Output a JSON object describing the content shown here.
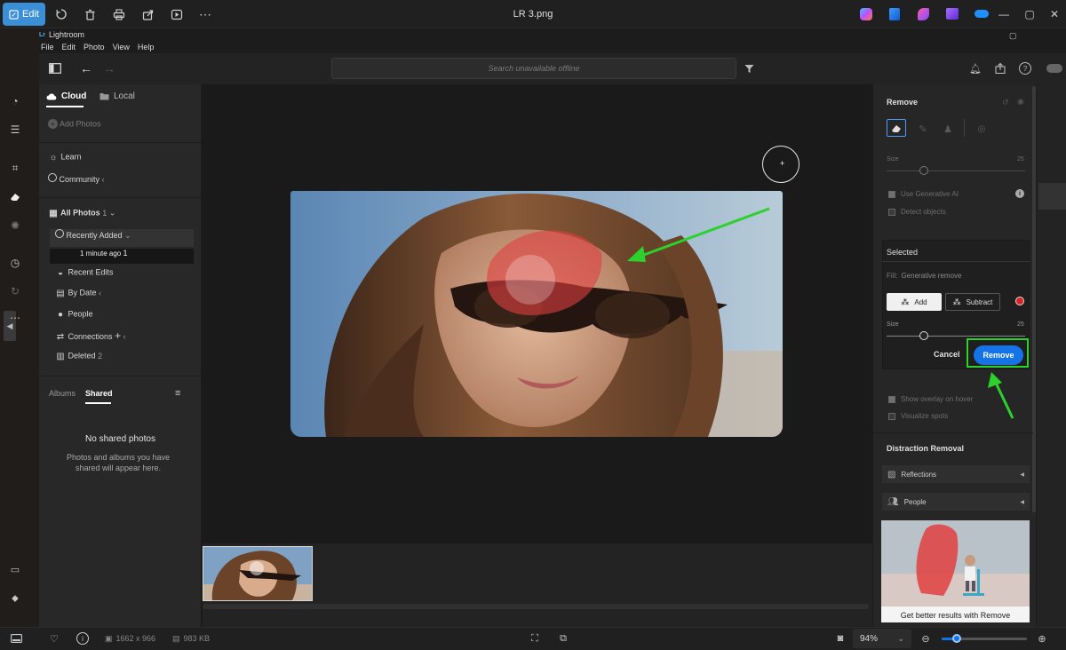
{
  "viewer": {
    "edit_label": "Edit",
    "file_name": "LR 3.png"
  },
  "lightroom": {
    "app_name": "Lightroom",
    "menu": [
      "File",
      "Edit",
      "Photo",
      "View",
      "Help"
    ],
    "search_placeholder": "Search unavailable offline"
  },
  "left_panel": {
    "tabs": {
      "cloud": "Cloud",
      "local": "Local"
    },
    "add_photos": "Add Photos",
    "learn": "Learn",
    "community": "Community",
    "all_photos": {
      "label": "All Photos",
      "count": "1"
    },
    "recently_added": "Recently Added",
    "one_minute_ago": {
      "label": "1 minute ago",
      "count": "1"
    },
    "recent_edits": "Recent Edits",
    "by_date": "By Date",
    "people": "People",
    "connections": "Connections",
    "deleted": {
      "label": "Deleted",
      "count": "2"
    },
    "album_tabs": {
      "albums": "Albums",
      "shared": "Shared"
    },
    "empty_title": "No shared photos",
    "empty_text": "Photos and albums you have shared will appear here."
  },
  "right_panel": {
    "title": "Remove",
    "size_label": "Size",
    "size_value": "25",
    "use_gen_ai": "Use Generative AI",
    "detect_objects": "Detect objects",
    "selected": {
      "title": "Selected",
      "fill_label": "Fill:",
      "fill_value": "Generative remove",
      "add": "Add",
      "subtract": "Subtract",
      "size_label": "Size",
      "size_value": "25",
      "cancel": "Cancel",
      "remove": "Remove"
    },
    "show_overlay": "Show overlay on hover",
    "visualize_spots": "Visualize spots",
    "distraction_removal": "Distraction Removal",
    "reflections": "Reflections",
    "people": "People",
    "promo_caption": "Get better results with Remove"
  },
  "status": {
    "dimensions": "1662 x 966",
    "file_size": "983 KB",
    "zoom": "94%",
    "zoom_fraction": 0.18
  },
  "colors": {
    "accent": "#1473e6",
    "annotation_green": "#2cd12c",
    "mask_red": "#e0403f"
  }
}
